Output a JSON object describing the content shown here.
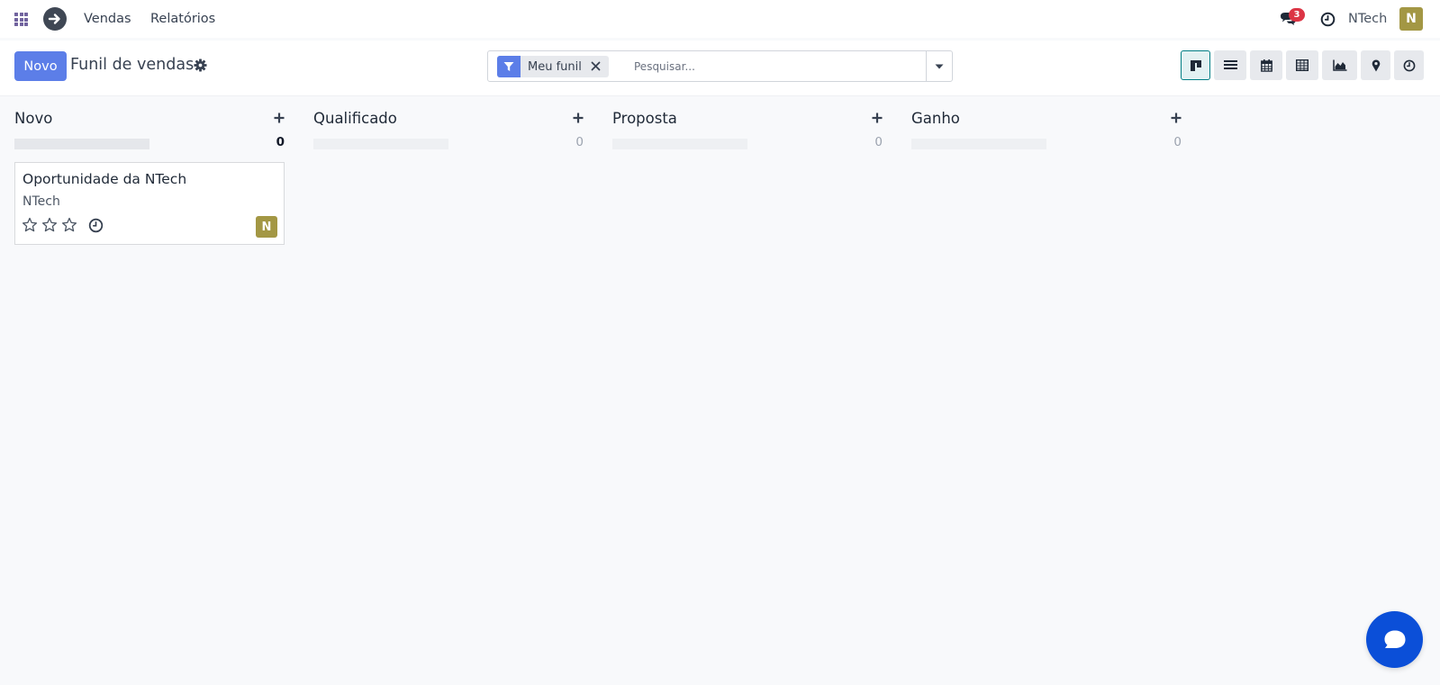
{
  "navbar": {
    "menu_vendas": "Vendas",
    "menu_relatorios": "Relatórios",
    "message_count": "3",
    "user_name": "NTech",
    "user_initial": "N"
  },
  "control_panel": {
    "new_button": "Novo",
    "title": "Funil de vendas",
    "search": {
      "facet_label": "Meu funil",
      "placeholder": "Pesquisar..."
    },
    "views": [
      "kanban-icon",
      "list-icon",
      "calendar-icon",
      "pivot-icon",
      "graph-icon",
      "map-icon",
      "activity-icon"
    ]
  },
  "kanban": {
    "columns": [
      {
        "title": "Novo",
        "count": "0"
      },
      {
        "title": "Qualificado",
        "count": "0"
      },
      {
        "title": "Proposta",
        "count": "0"
      },
      {
        "title": "Ganho",
        "count": "0"
      }
    ],
    "card": {
      "title": "Oportunidade da NTech",
      "customer": "NTech",
      "stars": 0,
      "avatar_initial": "N"
    }
  },
  "colors": {
    "primary": "#5c7ee8",
    "avatar": "#a39744",
    "badge": "#dc3545",
    "chat_fab": "#0b4fd8",
    "active_view": "#017e84"
  }
}
